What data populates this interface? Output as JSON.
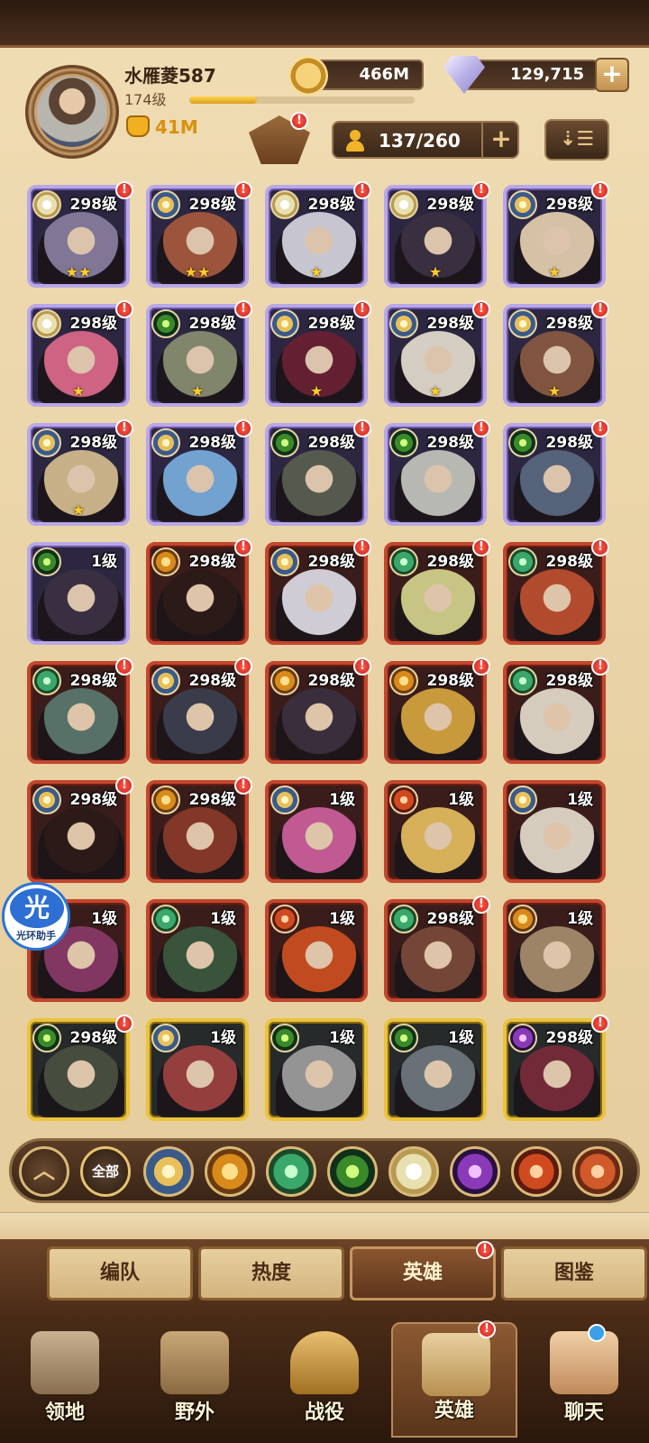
{
  "player": {
    "name": "水雁菱587",
    "level": "174级",
    "power": "41M",
    "xp_fraction": 0.3
  },
  "resources": {
    "gold": "466M",
    "gems": "129,715"
  },
  "heroes_count": "137/260",
  "colors": {
    "purple_frame": "#b9a8e6",
    "red_frame": "#c2462e",
    "gold_frame": "#e9c33c",
    "badge": "#e0352a"
  },
  "heroes": [
    {
      "level": "298级",
      "frame": "purple",
      "stars": "★★",
      "faction": "celestial",
      "badge": "!",
      "portrait": "#8a7fa0"
    },
    {
      "level": "298级",
      "frame": "purple",
      "stars": "★★",
      "faction": "lightbearer",
      "badge": "!",
      "portrait": "#a85a3c"
    },
    {
      "level": "298级",
      "frame": "purple",
      "stars": "★",
      "faction": "celestial",
      "badge": "!",
      "portrait": "#d8d8e0"
    },
    {
      "level": "298级",
      "frame": "purple",
      "stars": "★",
      "faction": "celestial",
      "badge": "!",
      "portrait": "#3a3040"
    },
    {
      "level": "298级",
      "frame": "purple",
      "stars": "★",
      "faction": "lightbearer",
      "badge": "!",
      "portrait": "#e8d2b0"
    },
    {
      "level": "298级",
      "frame": "purple",
      "stars": "★",
      "faction": "celestial",
      "badge": "!",
      "portrait": "#e06a8a"
    },
    {
      "level": "298级",
      "frame": "purple",
      "stars": "★",
      "faction": "graveborn",
      "badge": "!",
      "portrait": "#8a9070"
    },
    {
      "level": "298级",
      "frame": "purple",
      "stars": "★",
      "faction": "lightbearer",
      "badge": "!",
      "portrait": "#6a2030"
    },
    {
      "level": "298级",
      "frame": "purple",
      "stars": "★",
      "faction": "lightbearer",
      "badge": "!",
      "portrait": "#e8e0d0"
    },
    {
      "level": "298级",
      "frame": "purple",
      "stars": "★",
      "faction": "lightbearer",
      "badge": "!",
      "portrait": "#8a5a40"
    },
    {
      "level": "298级",
      "frame": "purple",
      "stars": "★",
      "faction": "lightbearer",
      "badge": "!",
      "portrait": "#d8c090"
    },
    {
      "level": "298级",
      "frame": "purple",
      "stars": "",
      "faction": "lightbearer",
      "badge": "!",
      "portrait": "#7ab0e0"
    },
    {
      "level": "298级",
      "frame": "purple",
      "stars": "",
      "faction": "graveborn",
      "badge": "!",
      "portrait": "#5a6050"
    },
    {
      "level": "298级",
      "frame": "purple",
      "stars": "",
      "faction": "graveborn",
      "badge": "!",
      "portrait": "#c8c8c0"
    },
    {
      "level": "298级",
      "frame": "purple",
      "stars": "",
      "faction": "graveborn",
      "badge": "!",
      "portrait": "#5a6a80"
    },
    {
      "level": "1级",
      "frame": "purple",
      "stars": "",
      "faction": "graveborn",
      "badge": "",
      "portrait": "#3a3040"
    },
    {
      "level": "298级",
      "frame": "red",
      "stars": "",
      "faction": "mauler",
      "badge": "!",
      "portrait": "#2a1a18"
    },
    {
      "level": "298级",
      "frame": "red",
      "stars": "",
      "faction": "lightbearer",
      "badge": "!",
      "portrait": "#e0e0ea"
    },
    {
      "level": "298级",
      "frame": "red",
      "stars": "",
      "faction": "wilder",
      "badge": "!",
      "portrait": "#d8d890"
    },
    {
      "level": "298级",
      "frame": "red",
      "stars": "",
      "faction": "wilder",
      "badge": "!",
      "portrait": "#c05030"
    },
    {
      "level": "298级",
      "frame": "red",
      "stars": "",
      "faction": "wilder",
      "badge": "!",
      "portrait": "#5a7a70"
    },
    {
      "level": "298级",
      "frame": "red",
      "stars": "",
      "faction": "lightbearer",
      "badge": "!",
      "portrait": "#3a4050"
    },
    {
      "level": "298级",
      "frame": "red",
      "stars": "",
      "faction": "mauler",
      "badge": "!",
      "portrait": "#3a3040"
    },
    {
      "level": "298级",
      "frame": "red",
      "stars": "",
      "faction": "mauler",
      "badge": "!",
      "portrait": "#d8a840"
    },
    {
      "level": "298级",
      "frame": "red",
      "stars": "",
      "faction": "wilder",
      "badge": "!",
      "portrait": "#e8e0d0"
    },
    {
      "level": "298级",
      "frame": "red",
      "stars": "",
      "faction": "lightbearer",
      "badge": "!",
      "portrait": "#2a1a18"
    },
    {
      "level": "298级",
      "frame": "red",
      "stars": "",
      "faction": "mauler",
      "badge": "!",
      "portrait": "#8a3a2a"
    },
    {
      "level": "1级",
      "frame": "red",
      "stars": "",
      "faction": "lightbearer",
      "badge": "",
      "portrait": "#d060a0"
    },
    {
      "level": "1级",
      "frame": "red",
      "stars": "",
      "faction": "dimensional",
      "badge": "",
      "portrait": "#e8c060"
    },
    {
      "level": "1级",
      "frame": "red",
      "stars": "",
      "faction": "lightbearer",
      "badge": "",
      "portrait": "#e8e0d0"
    },
    {
      "level": "1级",
      "frame": "red",
      "stars": "",
      "faction": "dimensional",
      "badge": "",
      "portrait": "#8a3a6a"
    },
    {
      "level": "1级",
      "frame": "red",
      "stars": "",
      "faction": "wilder",
      "badge": "",
      "portrait": "#3a5a40"
    },
    {
      "level": "1级",
      "frame": "red",
      "stars": "",
      "faction": "dimensional",
      "badge": "",
      "portrait": "#d05020"
    },
    {
      "level": "298级",
      "frame": "red",
      "stars": "",
      "faction": "wilder",
      "badge": "!",
      "portrait": "#7a4a3a"
    },
    {
      "level": "1级",
      "frame": "red",
      "stars": "",
      "faction": "mauler",
      "badge": "",
      "portrait": "#a89070"
    },
    {
      "level": "298级",
      "frame": "gold",
      "stars": "",
      "faction": "graveborn",
      "badge": "!",
      "portrait": "#4a5040"
    },
    {
      "level": "1级",
      "frame": "gold",
      "stars": "",
      "faction": "lightbearer",
      "badge": "",
      "portrait": "#a04040"
    },
    {
      "level": "1级",
      "frame": "gold",
      "stars": "",
      "faction": "graveborn",
      "badge": "",
      "portrait": "#a0a0a0"
    },
    {
      "level": "1级",
      "frame": "gold",
      "stars": "",
      "faction": "graveborn",
      "badge": "",
      "portrait": "#707880"
    },
    {
      "level": "298级",
      "frame": "gold",
      "stars": "",
      "faction": "hypogean",
      "badge": "!",
      "portrait": "#7a2a3a"
    }
  ],
  "faction_filter": {
    "all_label": "全部",
    "icons": [
      "lightbearer",
      "mauler",
      "wilder",
      "graveborn",
      "celestial",
      "hypogean",
      "dimensional",
      "dragon"
    ]
  },
  "helper": {
    "glyph": "光",
    "label": "光环助手"
  },
  "subtabs": [
    {
      "label": "编队",
      "active": false,
      "badge": ""
    },
    {
      "label": "热度",
      "active": false,
      "badge": ""
    },
    {
      "label": "英雄",
      "active": true,
      "badge": "!"
    },
    {
      "label": "图鉴",
      "active": false,
      "badge": ""
    }
  ],
  "nav": [
    {
      "label": "领地",
      "icon": "castle-icon",
      "active": false
    },
    {
      "label": "野外",
      "icon": "map-scroll-icon",
      "active": false
    },
    {
      "label": "战役",
      "icon": "sword-icon",
      "active": false
    },
    {
      "label": "英雄",
      "icon": "helmet-icon",
      "active": true
    },
    {
      "label": "聊天",
      "icon": "chat-icon",
      "active": false
    }
  ]
}
